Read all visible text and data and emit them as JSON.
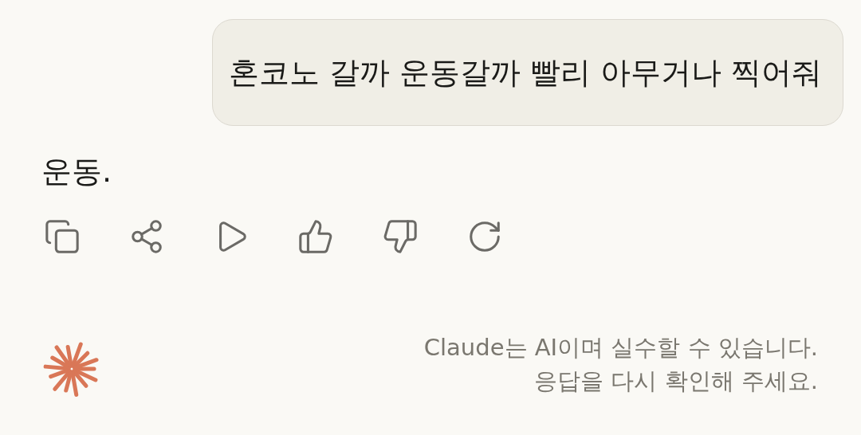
{
  "user_message": "혼코노 갈까 운동갈까 빨리 아무거나 찍어줘",
  "response": "운동.",
  "disclaimer": [
    "Claude는 AI이며 실수할 수 있습니다.",
    "응답을 다시 확인해 주세요."
  ]
}
